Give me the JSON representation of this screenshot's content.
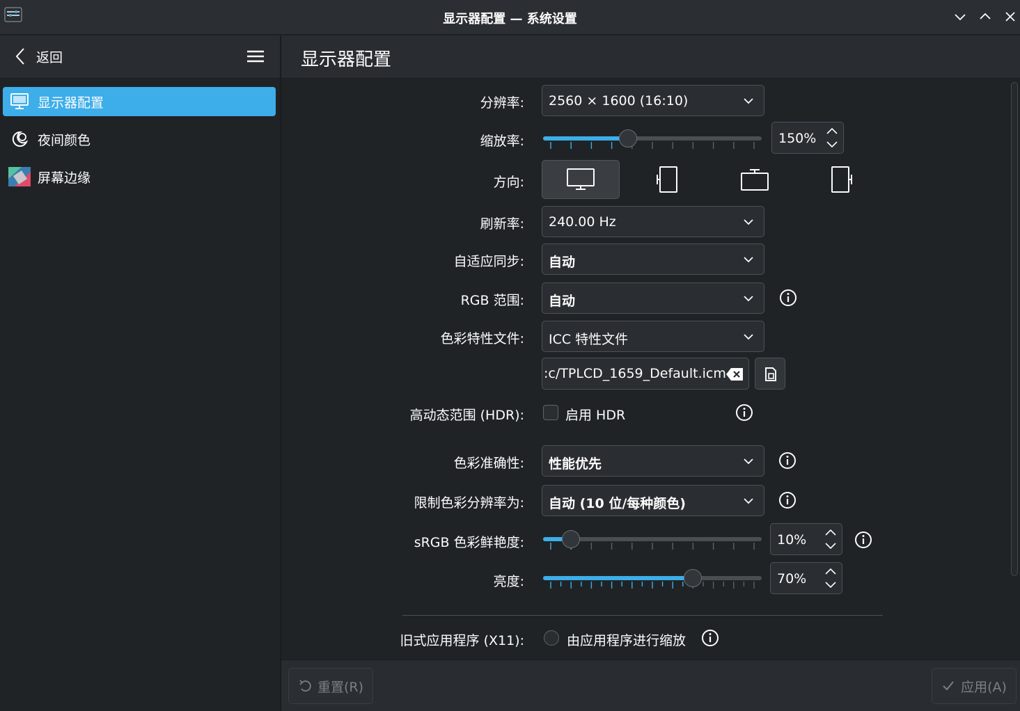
{
  "window": {
    "title": "显示器配置 — 系统设置"
  },
  "sidebar": {
    "back_label": "返回",
    "items": [
      {
        "label": "显示器配置",
        "icon": "monitor-icon",
        "active": true
      },
      {
        "label": "夜间颜色",
        "icon": "night-color-icon",
        "active": false
      },
      {
        "label": "屏幕边缘",
        "icon": "screen-edges-icon",
        "active": false
      }
    ]
  },
  "main": {
    "title": "显示器配置",
    "resolution": {
      "label": "分辨率:",
      "value": "2560 × 1600 (16:10)"
    },
    "scale": {
      "label": "缩放率:",
      "value": "150%",
      "level": 0.38
    },
    "orientation": {
      "label": "方向:",
      "options": [
        "landscape-icon",
        "portrait-left-icon",
        "landscape-flipped-icon",
        "portrait-right-icon"
      ],
      "selected": 0
    },
    "refresh": {
      "label": "刷新率:",
      "value": "240.00 Hz"
    },
    "adaptive_sync": {
      "label": "自适应同步:",
      "value": "自动"
    },
    "rgb_range": {
      "label": "RGB 范围:",
      "value": "自动"
    },
    "color_profile": {
      "label": "色彩特性文件:",
      "value": "ICC 特性文件",
      "path": ":c/TPLCD_1659_Default.icm"
    },
    "hdr": {
      "label": "高动态范围 (HDR):",
      "checkbox_label": "启用 HDR",
      "checked": false
    },
    "color_accuracy": {
      "label": "色彩准确性:",
      "value": "性能优先"
    },
    "color_depth": {
      "label": "限制色彩分辨率为:",
      "value": "自动 (10 位/每种颜色)"
    },
    "srgb_vividness": {
      "label": "sRGB 色彩鲜艳度:",
      "value": "10%",
      "level": 0.1
    },
    "brightness": {
      "label": "亮度:",
      "value": "70%",
      "level": 0.7
    },
    "legacy_apps": {
      "label": "旧式应用程序 (X11):",
      "radio_label": "由应用程序进行缩放",
      "checked": false
    }
  },
  "footer": {
    "reset_label": "重置(R)",
    "apply_label": "应用(A)"
  },
  "colors": {
    "accent": "#3daee9",
    "background": "#202326",
    "header": "#292c30"
  }
}
